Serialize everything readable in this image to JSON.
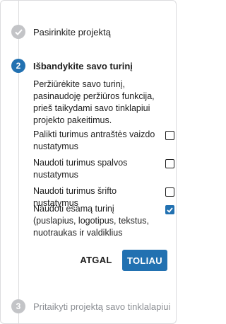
{
  "steps": [
    {
      "number": "✓",
      "title": "Pasirinkite projektą",
      "state": "done"
    },
    {
      "number": "2",
      "title": "Išbandykite savo turinį",
      "state": "active"
    },
    {
      "number": "3",
      "title": "Pritaikyti projektą savo tinklalapiui",
      "state": "pending"
    }
  ],
  "active_step": {
    "description": "Peržiūrėkite savo turinį, pasinaudoję peržiūros funkcija, prieš taikydami savo tinklapiui projekto pakeitimus.",
    "options": [
      {
        "label": "Palikti turimus antraštės vaizdo nustatymus",
        "checked": false
      },
      {
        "label": "Naudoti turimus spalvos nustatymus",
        "checked": false
      },
      {
        "label": "Naudoti turimus šrifto nustatymus",
        "checked": false
      },
      {
        "label": "Naudoti esamą turinį (puslapius, logotipus, tekstus, nuotraukas ir valdiklius",
        "checked": true
      }
    ],
    "back_label": "ATGAL",
    "next_label": "TOLIAU"
  },
  "colors": {
    "accent": "#2271b1",
    "done_circle": "#c3c4c7",
    "pending_circle": "#c3c4c7",
    "pending_text": "#8c8f94"
  }
}
